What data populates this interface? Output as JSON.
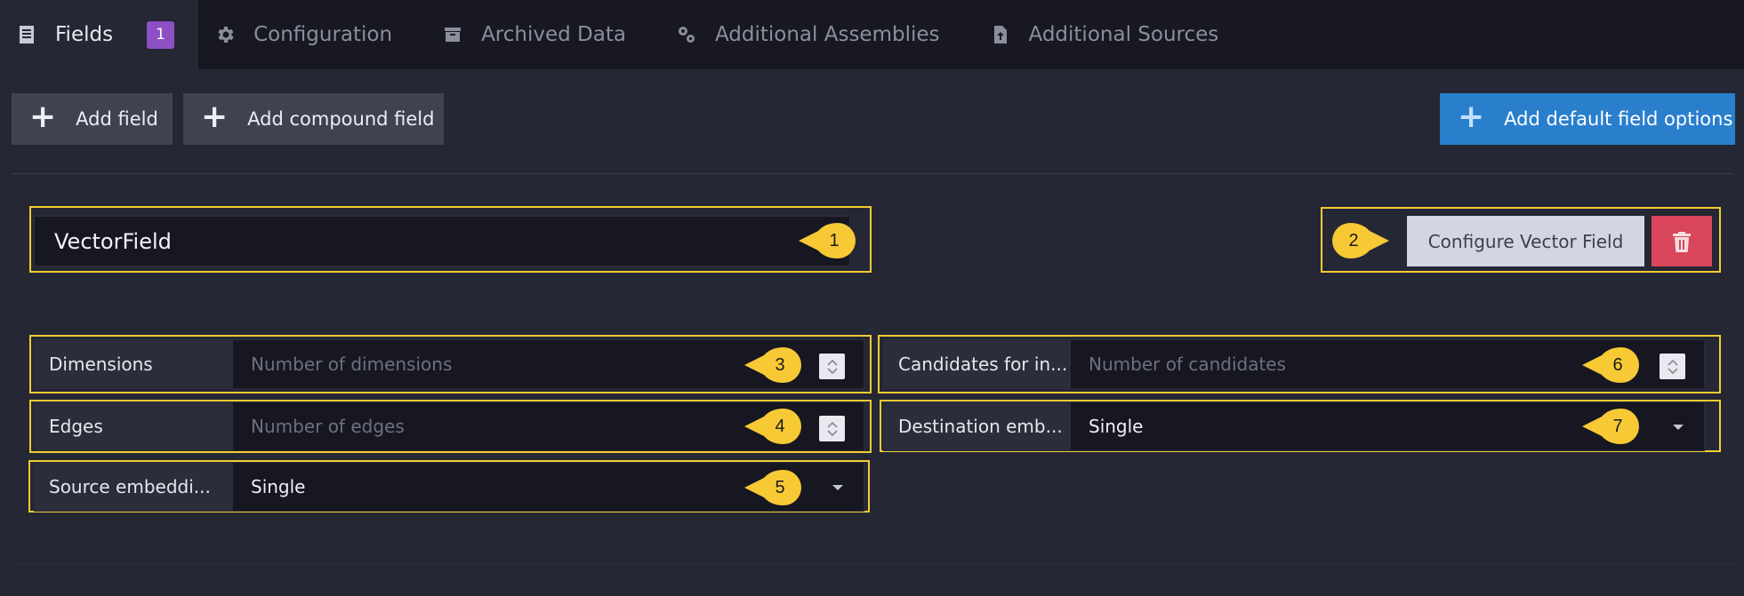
{
  "tabs": [
    {
      "label": "Fields",
      "icon": "list-icon",
      "active": true,
      "badge": "1"
    },
    {
      "label": "Configuration",
      "icon": "gear-icon"
    },
    {
      "label": "Archived Data",
      "icon": "archive-icon"
    },
    {
      "label": "Additional Assemblies",
      "icon": "gears-icon"
    },
    {
      "label": "Additional Sources",
      "icon": "file-upload-icon"
    }
  ],
  "toolbar": {
    "add_field": "Add field",
    "add_compound_field": "Add compound field",
    "add_default_field_options": "Add default field options"
  },
  "field": {
    "name": "VectorField",
    "configure_button": "Configure Vector Field",
    "delete_icon": "trash-icon"
  },
  "properties": {
    "dimensions": {
      "label": "Dimensions",
      "placeholder": "Number of dimensions"
    },
    "edges": {
      "label": "Edges",
      "placeholder": "Number of edges"
    },
    "source_embedding": {
      "label": "Source embeddi...",
      "value": "Single"
    },
    "candidates": {
      "label": "Candidates for in...",
      "placeholder": "Number of candidates"
    },
    "destination_embedding": {
      "label": "Destination emb...",
      "value": "Single"
    }
  },
  "markers": [
    "1",
    "2",
    "3",
    "4",
    "5",
    "6",
    "7"
  ],
  "colors": {
    "accent_blue": "#2a7fcd",
    "badge_purple": "#8e4fc4",
    "delete_red": "#d9465b",
    "highlight_yellow": "#f3cc33",
    "background": "#252734"
  }
}
